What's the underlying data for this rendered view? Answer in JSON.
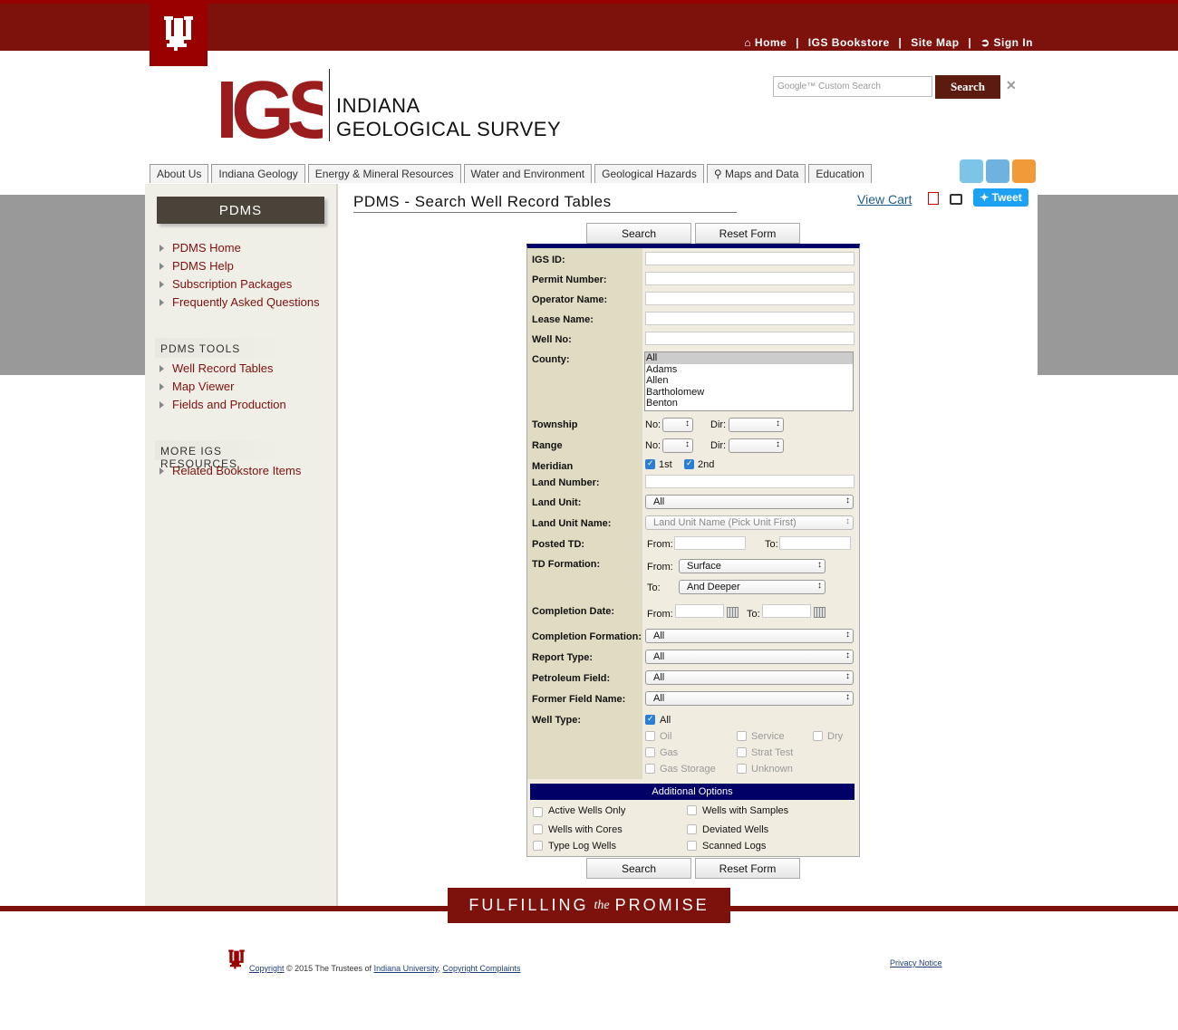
{
  "top_nav": {
    "home": "Home",
    "bookstore": "IGS Bookstore",
    "sitemap": "Site Map",
    "signin": "Sign In",
    "sep": "|"
  },
  "brand": {
    "line1": "INDIANA",
    "line2": "GEOLOGICAL SURVEY",
    "logo_text": "IGS",
    "accent": "#7d110c"
  },
  "search": {
    "placeholder": "Google™ Custom Search",
    "button": "Search"
  },
  "tabs": [
    "About Us",
    "Indiana Geology",
    "Energy & Mineral Resources",
    "Water and Environment",
    "Geological Hazards",
    "Maps and Data",
    "Education"
  ],
  "sidebar": {
    "header": "PDMS",
    "links": [
      "PDMS Home",
      "PDMS Help",
      "Subscription Packages",
      "Frequently Asked Questions"
    ],
    "tools_title": "PDMS TOOLS",
    "tools": [
      "Well Record Tables",
      "Map Viewer",
      "Fields and Production"
    ],
    "more_title": "MORE IGS RESOURCES",
    "more": [
      "Related Bookstore Items"
    ]
  },
  "page": {
    "title": "PDMS - Search Well Record Tables",
    "view_cart": "View Cart",
    "tweet": "Tweet"
  },
  "buttons": {
    "search": "Search",
    "reset": "Reset Form"
  },
  "form": {
    "igs_id": "IGS ID:",
    "permit": "Permit Number:",
    "operator": "Operator Name:",
    "lease": "Lease Name:",
    "well_no": "Well No:",
    "county": "County:",
    "county_options": [
      "All",
      "Adams",
      "Allen",
      "Bartholomew",
      "Benton"
    ],
    "township": "Township",
    "range": "Range",
    "no_label": "No:",
    "dir_label": "Dir:",
    "meridian": "Meridian",
    "meridian_1": "1st",
    "meridian_2": "2nd",
    "land_number": "Land Number:",
    "land_unit": "Land Unit:",
    "land_unit_value": "All",
    "land_unit_name": "Land Unit Name:",
    "land_unit_name_value": "Land Unit Name (Pick Unit First)",
    "posted_td": "Posted TD:",
    "from": "From:",
    "to": "To:",
    "td_formation": "TD Formation:",
    "td_from_value": "Surface",
    "td_to_value": "And Deeper",
    "completion_date": "Completion Date:",
    "completion_formation": "Completion Formation:",
    "report_type": "Report Type:",
    "petroleum_field": "Petroleum Field:",
    "former_field": "Former Field Name:",
    "all": "All",
    "well_type": "Well Type:",
    "well_types": {
      "all": "All",
      "oil": "Oil",
      "service": "Service",
      "dry": "Dry",
      "gas": "Gas",
      "strat": "Strat Test",
      "gas_storage": "Gas Storage",
      "unknown": "Unknown"
    }
  },
  "additional": {
    "title": "Additional Options",
    "active": "Active Wells Only",
    "samples": "Wells with Samples",
    "cores": "Wells with Cores",
    "deviated": "Deviated Wells",
    "typelog": "Type Log Wells",
    "scanned": "Scanned Logs"
  },
  "footer": {
    "tagline_1": "FULFILLING",
    "tagline_the": "the",
    "tagline_2": "PROMISE",
    "copyright_link": "Copyright",
    "copyright_text": " © 2015 The Trustees of ",
    "iu_link": "Indiana University",
    "comma": ", ",
    "complaints": "Copyright Complaints",
    "privacy": "Privacy Notice"
  }
}
